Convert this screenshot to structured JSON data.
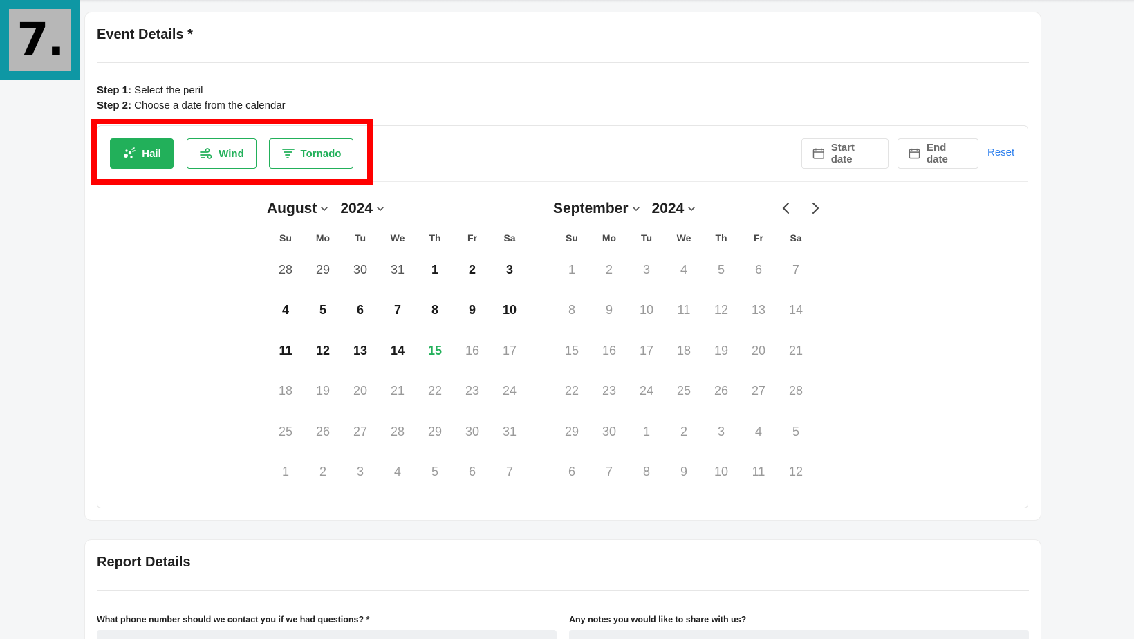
{
  "step_badge": "7.",
  "event_details": {
    "title": "Event Details *",
    "step1_label": "Step 1:",
    "step1_text": " Select the peril",
    "step2_label": "Step 2:",
    "step2_text": " Choose a date from the calendar",
    "perils": [
      {
        "label": "Hail",
        "icon": "hail-icon",
        "active": true
      },
      {
        "label": "Wind",
        "icon": "wind-icon",
        "active": false
      },
      {
        "label": "Tornado",
        "icon": "tornado-icon",
        "active": false
      }
    ],
    "start_date_label": "Start date",
    "end_date_label": "End date",
    "reset_label": "Reset",
    "weekdays": [
      "Su",
      "Mo",
      "Tu",
      "We",
      "Th",
      "Fr",
      "Sa"
    ],
    "months": [
      {
        "month": "August",
        "year": "2024",
        "days": [
          {
            "d": "28",
            "s": "other"
          },
          {
            "d": "29",
            "s": "other"
          },
          {
            "d": "30",
            "s": "other"
          },
          {
            "d": "31",
            "s": "other"
          },
          {
            "d": "1",
            "s": "strong"
          },
          {
            "d": "2",
            "s": "strong"
          },
          {
            "d": "3",
            "s": "strong"
          },
          {
            "d": "4",
            "s": "strong"
          },
          {
            "d": "5",
            "s": "strong"
          },
          {
            "d": "6",
            "s": "strong"
          },
          {
            "d": "7",
            "s": "strong"
          },
          {
            "d": "8",
            "s": "strong"
          },
          {
            "d": "9",
            "s": "strong"
          },
          {
            "d": "10",
            "s": "strong"
          },
          {
            "d": "11",
            "s": "strong"
          },
          {
            "d": "12",
            "s": "strong"
          },
          {
            "d": "13",
            "s": "strong"
          },
          {
            "d": "14",
            "s": "strong"
          },
          {
            "d": "15",
            "s": "today"
          },
          {
            "d": "16",
            "s": "disabled"
          },
          {
            "d": "17",
            "s": "disabled"
          },
          {
            "d": "18",
            "s": "disabled"
          },
          {
            "d": "19",
            "s": "disabled"
          },
          {
            "d": "20",
            "s": "disabled"
          },
          {
            "d": "21",
            "s": "disabled"
          },
          {
            "d": "22",
            "s": "disabled"
          },
          {
            "d": "23",
            "s": "disabled"
          },
          {
            "d": "24",
            "s": "disabled"
          },
          {
            "d": "25",
            "s": "disabled"
          },
          {
            "d": "26",
            "s": "disabled"
          },
          {
            "d": "27",
            "s": "disabled"
          },
          {
            "d": "28",
            "s": "disabled"
          },
          {
            "d": "29",
            "s": "disabled"
          },
          {
            "d": "30",
            "s": "disabled"
          },
          {
            "d": "31",
            "s": "disabled"
          },
          {
            "d": "1",
            "s": "disabled"
          },
          {
            "d": "2",
            "s": "disabled"
          },
          {
            "d": "3",
            "s": "disabled"
          },
          {
            "d": "4",
            "s": "disabled"
          },
          {
            "d": "5",
            "s": "disabled"
          },
          {
            "d": "6",
            "s": "disabled"
          },
          {
            "d": "7",
            "s": "disabled"
          }
        ]
      },
      {
        "month": "September",
        "year": "2024",
        "days": [
          {
            "d": "1",
            "s": "disabled"
          },
          {
            "d": "2",
            "s": "disabled"
          },
          {
            "d": "3",
            "s": "disabled"
          },
          {
            "d": "4",
            "s": "disabled"
          },
          {
            "d": "5",
            "s": "disabled"
          },
          {
            "d": "6",
            "s": "disabled"
          },
          {
            "d": "7",
            "s": "disabled"
          },
          {
            "d": "8",
            "s": "disabled"
          },
          {
            "d": "9",
            "s": "disabled"
          },
          {
            "d": "10",
            "s": "disabled"
          },
          {
            "d": "11",
            "s": "disabled"
          },
          {
            "d": "12",
            "s": "disabled"
          },
          {
            "d": "13",
            "s": "disabled"
          },
          {
            "d": "14",
            "s": "disabled"
          },
          {
            "d": "15",
            "s": "disabled"
          },
          {
            "d": "16",
            "s": "disabled"
          },
          {
            "d": "17",
            "s": "disabled"
          },
          {
            "d": "18",
            "s": "disabled"
          },
          {
            "d": "19",
            "s": "disabled"
          },
          {
            "d": "20",
            "s": "disabled"
          },
          {
            "d": "21",
            "s": "disabled"
          },
          {
            "d": "22",
            "s": "disabled"
          },
          {
            "d": "23",
            "s": "disabled"
          },
          {
            "d": "24",
            "s": "disabled"
          },
          {
            "d": "25",
            "s": "disabled"
          },
          {
            "d": "26",
            "s": "disabled"
          },
          {
            "d": "27",
            "s": "disabled"
          },
          {
            "d": "28",
            "s": "disabled"
          },
          {
            "d": "29",
            "s": "disabled"
          },
          {
            "d": "30",
            "s": "disabled"
          },
          {
            "d": "1",
            "s": "disabled"
          },
          {
            "d": "2",
            "s": "disabled"
          },
          {
            "d": "3",
            "s": "disabled"
          },
          {
            "d": "4",
            "s": "disabled"
          },
          {
            "d": "5",
            "s": "disabled"
          },
          {
            "d": "6",
            "s": "disabled"
          },
          {
            "d": "7",
            "s": "disabled"
          },
          {
            "d": "8",
            "s": "disabled"
          },
          {
            "d": "9",
            "s": "disabled"
          },
          {
            "d": "10",
            "s": "disabled"
          },
          {
            "d": "11",
            "s": "disabled"
          },
          {
            "d": "12",
            "s": "disabled"
          }
        ]
      }
    ]
  },
  "report_details": {
    "title": "Report Details",
    "phone_question": "What phone number should we contact you if we had questions? *",
    "notes_question": "Any notes you would like to share with us?"
  },
  "colors": {
    "accent_green": "#22b05a",
    "highlight_red": "#ff0000",
    "badge_teal": "#0e97a4",
    "link_blue": "#2f80ed"
  }
}
